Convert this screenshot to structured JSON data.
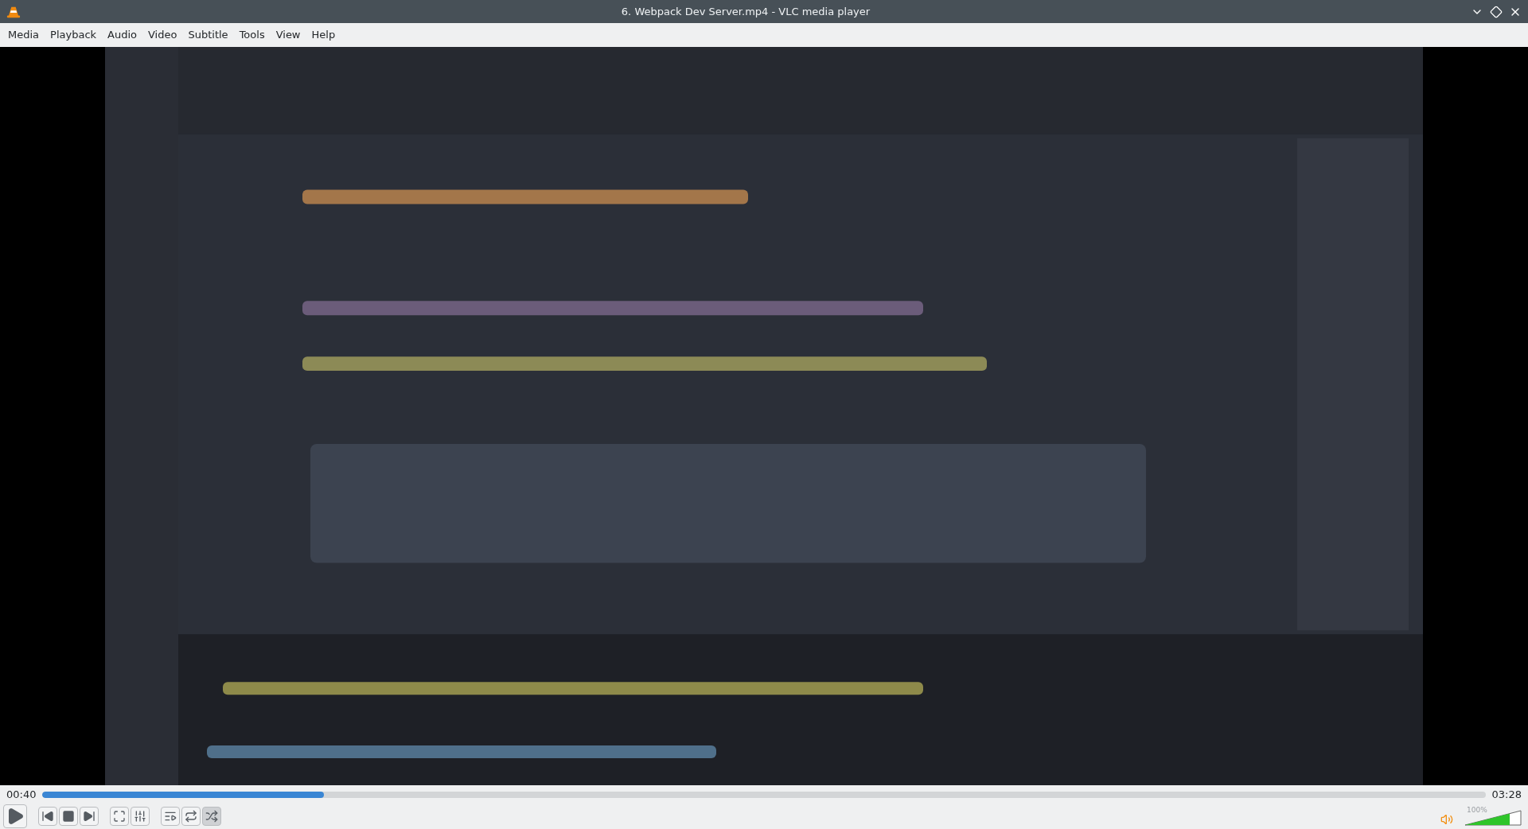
{
  "window": {
    "title": "6. Webpack Dev Server.mp4 - VLC media player"
  },
  "menu": [
    "Media",
    "Playback",
    "Audio",
    "Video",
    "Subtitle",
    "Tools",
    "View",
    "Help"
  ],
  "video": {
    "kind": "picture"
  },
  "seek": {
    "elapsed": "00:40",
    "total": "03:28",
    "level": 0.195
  },
  "controls": [
    {
      "kind": "play"
    },
    {
      "kind": "previous"
    },
    {
      "kind": "stop"
    },
    {
      "kind": "next"
    },
    {
      "kind": "fullscreen"
    },
    {
      "kind": "settings"
    },
    {
      "kind": "playlist"
    },
    {
      "kind": "loop",
      "on": false
    },
    {
      "kind": "random",
      "on": true
    }
  ],
  "volume": {
    "reading": "100%",
    "level": 0.8
  }
}
